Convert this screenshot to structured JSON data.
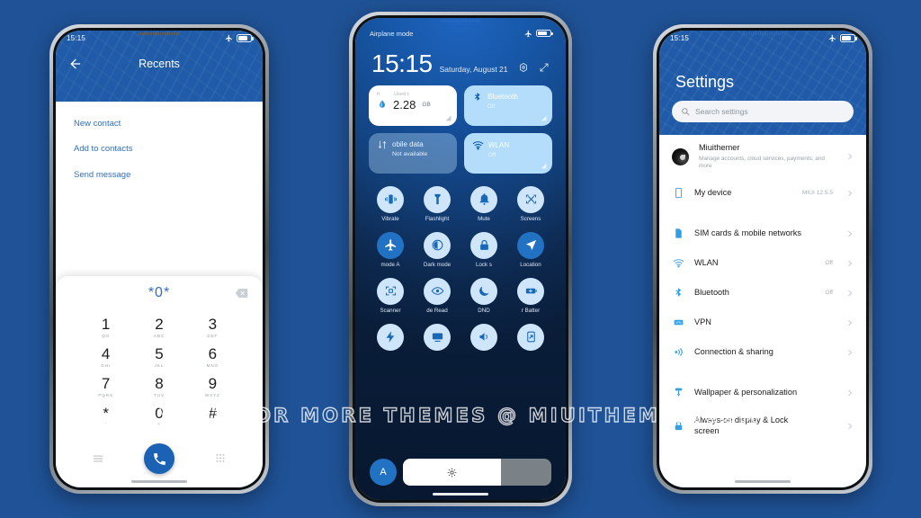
{
  "watermark": "VISIT FOR MORE THEMES @ MIUITHEMER.COM",
  "background_color": "#1f5296",
  "accent_color": "#1f5ba8",
  "phone1": {
    "status": {
      "time": "15:15",
      "airplane_icon": "airplane-icon",
      "battery_icon": "battery-icon"
    },
    "appbar": {
      "back_icon": "arrow-left-icon",
      "title": "Recents"
    },
    "menu_items": [
      {
        "label": "New contact"
      },
      {
        "label": "Add to contacts"
      },
      {
        "label": "Send message"
      }
    ],
    "dialer": {
      "number": "*0*",
      "delete_icon": "backspace-icon",
      "keys": [
        {
          "digit": "1",
          "letters": "QO"
        },
        {
          "digit": "2",
          "letters": "ABC"
        },
        {
          "digit": "3",
          "letters": "DEF"
        },
        {
          "digit": "4",
          "letters": "GHI"
        },
        {
          "digit": "5",
          "letters": "JKL"
        },
        {
          "digit": "6",
          "letters": "MNO"
        },
        {
          "digit": "7",
          "letters": "PQRS"
        },
        {
          "digit": "8",
          "letters": "TUV"
        },
        {
          "digit": "9",
          "letters": "WXYZ"
        },
        {
          "digit": "*",
          "letters": "'"
        },
        {
          "digit": "0",
          "letters": "+"
        },
        {
          "digit": "#",
          "letters": ""
        }
      ],
      "left_icon": "menu-list-icon",
      "call_icon": "phone-call-icon",
      "right_icon": "keypad-icon"
    }
  },
  "phone2": {
    "status": {
      "label": "Airplane mode",
      "airplane_icon": "airplane-icon",
      "battery_icon": "battery-icon"
    },
    "clock": {
      "time": "15:15",
      "date": "Saturday, August 21",
      "settings_icon": "gear-icon",
      "edit_icon": "edit-icon"
    },
    "big_tiles": [
      {
        "label": "Used t",
        "label2": "h",
        "value": "2.28",
        "unit": "GB",
        "icon": "data-usage-drop-icon",
        "style": "white"
      },
      {
        "label": "Bluetooth",
        "sub": "Off",
        "icon": "bluetooth-icon",
        "style": "lblue"
      },
      {
        "label": "obile data",
        "sub": "Not available",
        "icon": "mobile-data-icon",
        "style": "dim"
      },
      {
        "label": "WLAN",
        "sub": "Off",
        "icon": "wifi-icon",
        "style": "lblue"
      }
    ],
    "toggles": [
      {
        "label": "Vibrate",
        "icon": "vibrate-icon",
        "on": false
      },
      {
        "label": "Flashlight",
        "icon": "flashlight-icon",
        "on": false
      },
      {
        "label": "Mute",
        "icon": "bell-icon",
        "on": false
      },
      {
        "label": "Screens",
        "icon": "screenshot-icon",
        "on": false
      },
      {
        "label": "mode     A",
        "icon": "airplane-icon",
        "on": true
      },
      {
        "label": "Dark mode",
        "icon": "contrast-icon",
        "on": false
      },
      {
        "label": "Lock s",
        "icon": "lock-icon",
        "on": false
      },
      {
        "label": "Location",
        "icon": "location-icon",
        "on": true
      },
      {
        "label": "Scanner",
        "icon": "scan-icon",
        "on": false
      },
      {
        "label": "de    Read",
        "icon": "eye-icon",
        "on": false
      },
      {
        "label": "DND",
        "icon": "moon-icon",
        "on": false
      },
      {
        "label": "r    Batter",
        "icon": "battery-plus-icon",
        "on": false
      },
      {
        "label": "",
        "icon": "flash-icon",
        "on": false
      },
      {
        "label": "",
        "icon": "cast-icon",
        "on": false
      },
      {
        "label": "",
        "icon": "sound-share-icon",
        "on": false
      },
      {
        "label": "",
        "icon": "rotate-icon",
        "on": false
      }
    ],
    "brightness": {
      "auto_label": "A",
      "sun_icon": "sun-icon",
      "level": 66
    }
  },
  "phone3": {
    "status": {
      "time": "15:15",
      "airplane_icon": "airplane-icon",
      "battery_icon": "battery-icon"
    },
    "title": "Settings",
    "search": {
      "placeholder": "Search settings",
      "icon": "search-icon"
    },
    "account": {
      "name": "Miuithemer",
      "desc": "Manage accounts, cloud services, payments, and more",
      "avatar": "avatar"
    },
    "items": [
      {
        "label": "My device",
        "value": "MIUI 12.5.5",
        "icon": "device-icon"
      },
      {
        "label": "SIM cards & mobile networks",
        "value": "",
        "icon": "sim-icon"
      },
      {
        "label": "WLAN",
        "value": "Off",
        "icon": "wifi-icon"
      },
      {
        "label": "Bluetooth",
        "value": "Off",
        "icon": "bluetooth-icon"
      },
      {
        "label": "VPN",
        "value": "",
        "icon": "vpn-icon"
      },
      {
        "label": "Connection & sharing",
        "value": "",
        "icon": "connection-icon"
      },
      {
        "label": "Wallpaper & personalization",
        "value": "",
        "icon": "wallpaper-icon"
      },
      {
        "label": "Always-on display & Lock screen",
        "value": "",
        "icon": "lock-icon"
      }
    ]
  }
}
